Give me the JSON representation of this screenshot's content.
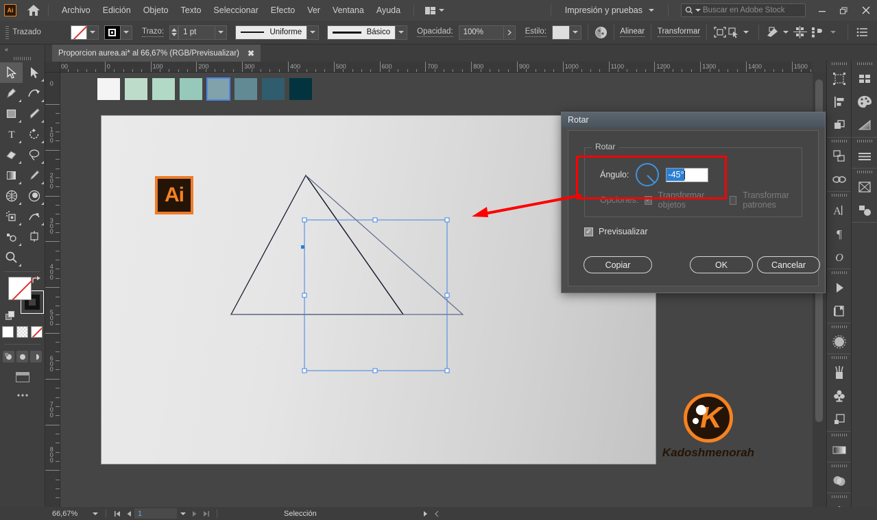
{
  "app": {
    "badge": "Ai",
    "home_icon": "home-icon"
  },
  "menubar": {
    "items": [
      "Archivo",
      "Edición",
      "Objeto",
      "Texto",
      "Seleccionar",
      "Efecto",
      "Ver",
      "Ventana",
      "Ayuda"
    ],
    "workspace": "Impresión y pruebas",
    "search_placeholder": "Buscar en Adobe Stock",
    "window_buttons": {
      "minimize": "—",
      "restore": "❐",
      "close": "✕"
    }
  },
  "controlbar": {
    "object_label": "Trazado",
    "stroke_label": "Trazo:",
    "stroke_weight": "1 pt",
    "profile_label": "Uniforme",
    "brush_label": "Básico",
    "opacity_label": "Opacidad:",
    "opacity_value": "100%",
    "style_label": "Estilo:",
    "align_label": "Alinear",
    "transform_label": "Transformar"
  },
  "document": {
    "tab_title": "Proporcion aurea.ai* al 66,67% (RGB/Previsualizar)",
    "close_glyph": "✖",
    "path_label": "trazado"
  },
  "rulers": {
    "horizontal_labels": [
      "00",
      "0",
      "100",
      "200",
      "300",
      "400",
      "500",
      "600",
      "700",
      "800",
      "900",
      "1000",
      "1100",
      "1200",
      "1300",
      "1400",
      "1500"
    ],
    "vertical_labels": [
      "0",
      "100",
      "200",
      "300",
      "400",
      "500",
      "600",
      "700",
      "800"
    ]
  },
  "artboard": {
    "swatches": [
      "#f4f4f4",
      "#bedcca",
      "#b2d9c6",
      "#97c9bb",
      "#81a2ab",
      "#618a95",
      "#2f5d6e",
      "#02333f"
    ],
    "selected_swatch_index": 4,
    "ai_logo_text": "Ai",
    "logo_letter": "K",
    "logo_name": "Kadoshmenorah",
    "accent_orange": "#f58220",
    "selection_blue": "#3d85e0"
  },
  "dialog": {
    "title": "Rotar",
    "group_title": "Rotar",
    "angle_label": "Ángulo:",
    "angle_value": "-45°",
    "options_label": "Opciones:",
    "option_objects": "Transformar objetos",
    "option_patterns": "Transformar patrones",
    "preview_label": "Previsualizar",
    "buttons": {
      "copy": "Copiar",
      "ok": "OK",
      "cancel": "Cancelar"
    },
    "highlight_color": "#fe0000"
  },
  "statusbar": {
    "zoom": "66,67%",
    "page": "1",
    "tool_status": "Selección"
  }
}
